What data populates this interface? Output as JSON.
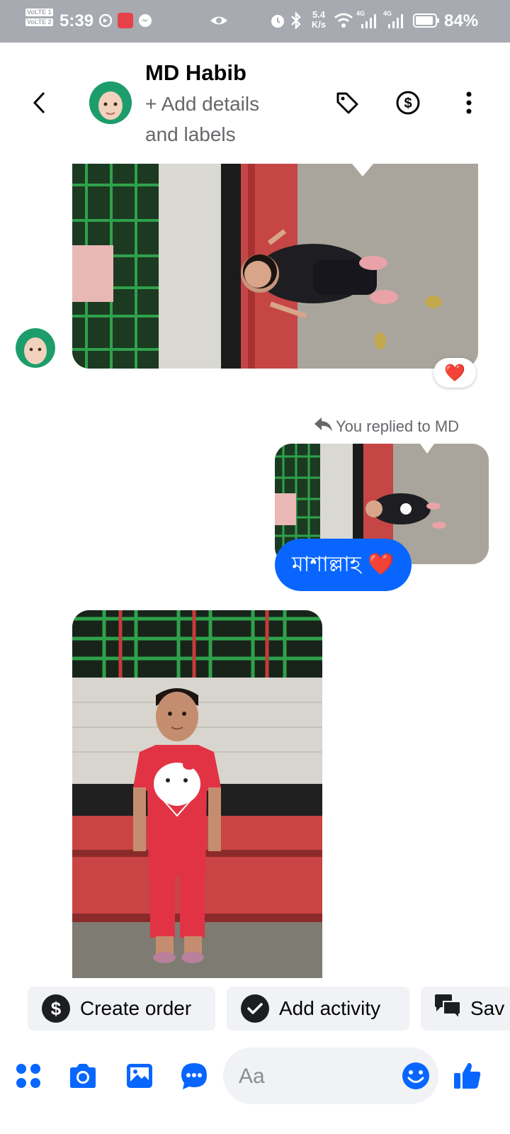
{
  "status_bar": {
    "time": "5:39",
    "volte1": "VoLTE 1",
    "volte2": "VoLTE 2",
    "speed_value": "5.4",
    "speed_unit": "K/s",
    "net1": "4G",
    "net2": "4G",
    "battery": "84%",
    "icons": [
      "whatsapp-icon",
      "tomato-app-icon",
      "messenger-icon",
      "eye-icon",
      "alarm-icon",
      "bluetooth-icon",
      "wifi-icon",
      "signal-icon",
      "battery-icon"
    ]
  },
  "header": {
    "contact_name": "MD Habib",
    "subtitle_line1": "+ Add details",
    "subtitle_line2": "and labels",
    "icons": [
      "back-arrow-icon",
      "label-tag-icon",
      "dollar-icon",
      "more-vert-icon"
    ]
  },
  "thread": {
    "reaction": "❤️",
    "reply_meta": "You replied to MD",
    "sent_message": "মাশাল্লাহ ❤️"
  },
  "quick_actions": {
    "create_order": "Create order",
    "add_activity": "Add activity",
    "saved": "Sav"
  },
  "composer": {
    "placeholder": "Aa",
    "icons": [
      "apps-grid-icon",
      "camera-icon",
      "gallery-icon",
      "chat-bubble-icon",
      "emoji-icon",
      "thumbs-up-icon"
    ]
  },
  "colors": {
    "accent": "#0866ff",
    "status_bar_bg": "#a7aab0",
    "chip_bg": "#f0f2f5",
    "secondary_text": "#65676b"
  }
}
